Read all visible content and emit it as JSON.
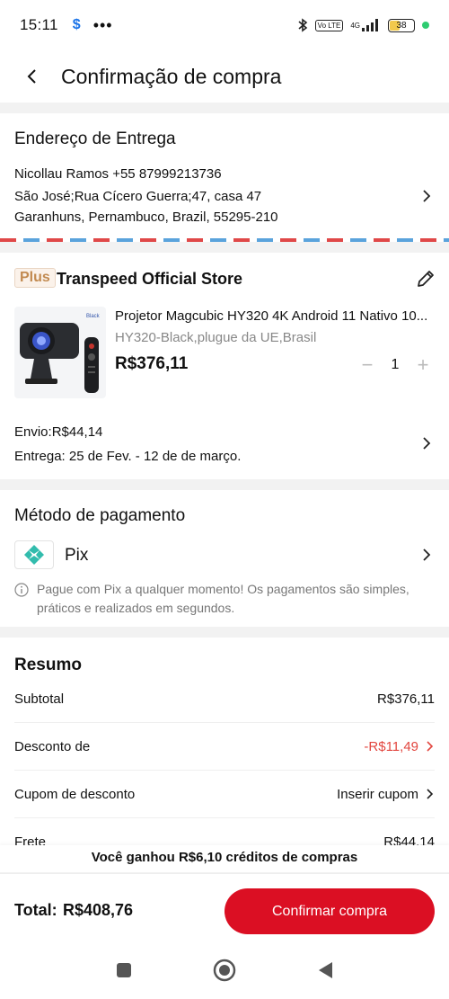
{
  "status_bar": {
    "time": "15:11",
    "app_badge": "$",
    "more": "•••",
    "network": "4G",
    "volte": "Vo LTE",
    "battery": "38"
  },
  "header": {
    "title": "Confirmação de compra"
  },
  "address": {
    "heading": "Endereço de Entrega",
    "name_phone": "Nicollau Ramos  +55 87999213736",
    "street": "São José;Rua Cícero Guerra;47, casa 47",
    "city": "Garanhuns, Pernambuco, Brazil, 55295-210"
  },
  "store": {
    "badge": "Plus",
    "name": "Transpeed Official Store",
    "product": {
      "title": "Projetor Magcubic HY320 4K Android 11 Nativo 10...",
      "variant": "HY320-Black,plugue da UE,Brasil",
      "price": "R$376,11",
      "quantity": "1",
      "image_tag": "Black"
    },
    "shipping": "Envio:R$44,14",
    "delivery": "Entrega: 25 de Fev. - 12 de de março."
  },
  "payment": {
    "heading": "Método de pagamento",
    "method": "Pix",
    "note": "Pague com Pix a qualquer momento! Os pagamentos são simples, práticos e realizados em segundos."
  },
  "summary": {
    "heading": "Resumo",
    "rows": [
      {
        "label": "Subtotal",
        "value": "R$376,11"
      },
      {
        "label": "Desconto de",
        "value": "-R$11,49"
      },
      {
        "label": "Cupom de desconto",
        "value": "Inserir cupom"
      },
      {
        "label": "Frete",
        "value": "R$44,14"
      }
    ]
  },
  "credits_banner": "Você ganhou R$6,10 créditos de compras",
  "footer": {
    "total_label": "Total:",
    "total_value": "R$408,76",
    "confirm_label": "Confirmar compra"
  },
  "colors": {
    "accent": "#db0f23",
    "discount": "#e2463f",
    "pix": "#32bcad",
    "plus_badge": "#c28a50"
  }
}
